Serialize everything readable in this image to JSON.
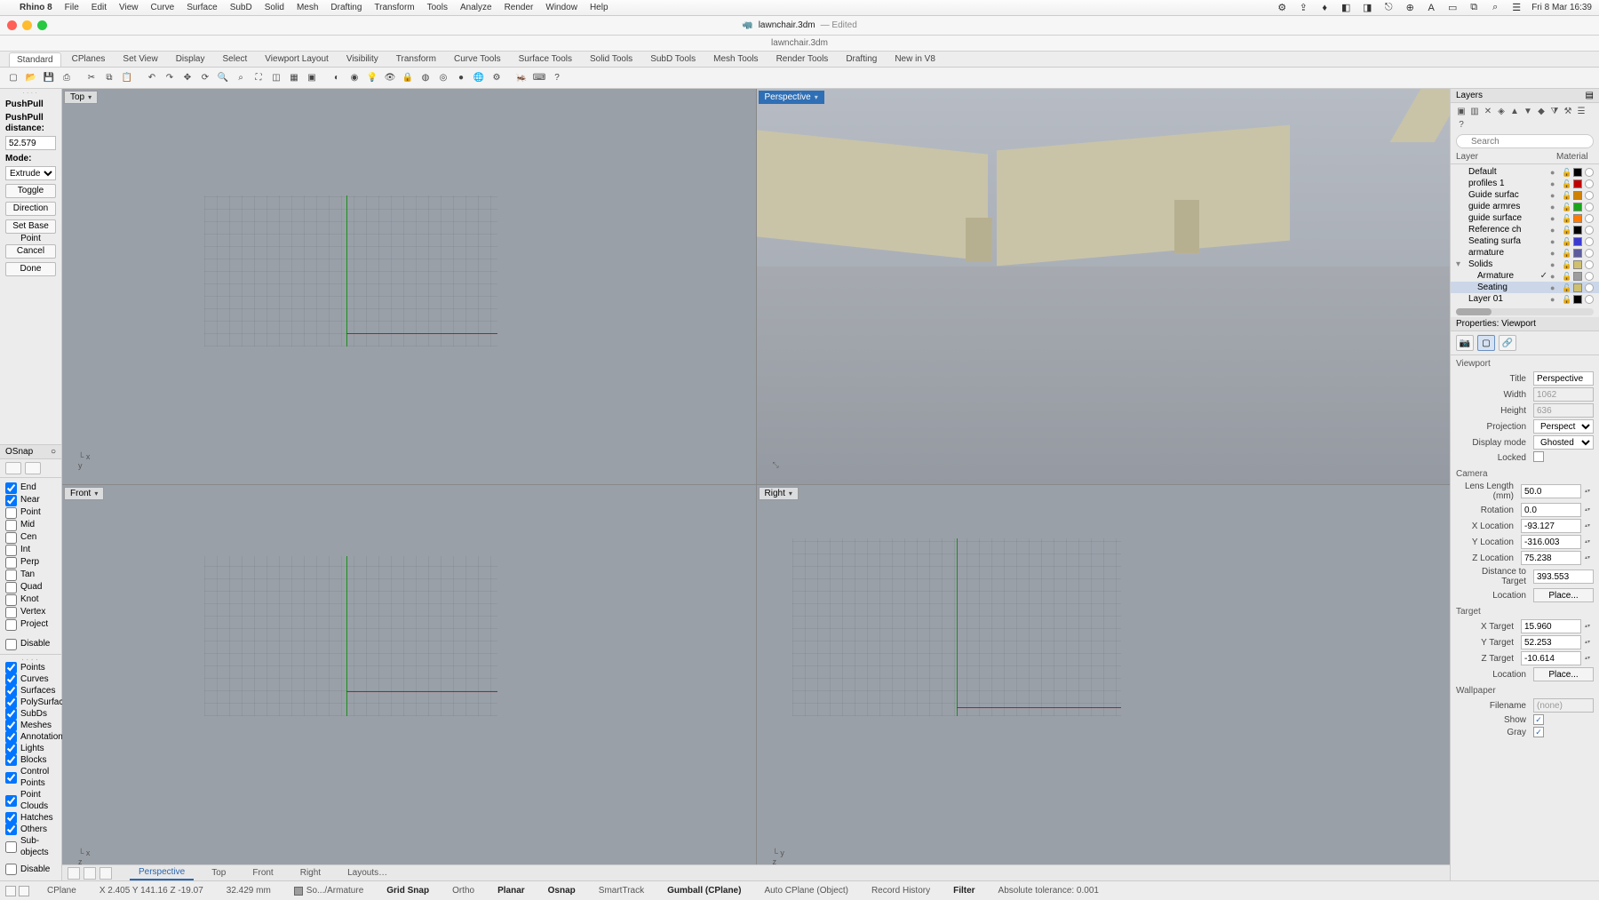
{
  "menubar": {
    "app": "Rhino 8",
    "items": [
      "File",
      "Edit",
      "View",
      "Curve",
      "Surface",
      "SubD",
      "Solid",
      "Mesh",
      "Drafting",
      "Transform",
      "Tools",
      "Analyze",
      "Render",
      "Window",
      "Help"
    ],
    "clock": "Fri 8 Mar 16:39"
  },
  "titlebar": {
    "doc_icon": "🦏",
    "filename": "lawnchair.3dm",
    "edited": "— Edited"
  },
  "subtitle": "lawnchair.3dm",
  "tooltabs": [
    "Standard",
    "CPlanes",
    "Set View",
    "Display",
    "Select",
    "Viewport Layout",
    "Visibility",
    "Transform",
    "Curve Tools",
    "Surface Tools",
    "Solid Tools",
    "SubD Tools",
    "Mesh Tools",
    "Render Tools",
    "Drafting",
    "New in V8"
  ],
  "activeTab": "Standard",
  "command": {
    "name": "PushPull",
    "dist_label": "PushPull distance:",
    "dist_value": "52.579",
    "mode_label": "Mode:",
    "mode_value": "Extrude",
    "toggle": "Toggle",
    "direction": "Direction",
    "setbase": "Set Base Point",
    "cancel": "Cancel",
    "done": "Done"
  },
  "osnap": {
    "title": "OSnap",
    "items": [
      {
        "label": "End",
        "on": true
      },
      {
        "label": "Near",
        "on": true
      },
      {
        "label": "Point",
        "on": false
      },
      {
        "label": "Mid",
        "on": false
      },
      {
        "label": "Cen",
        "on": false
      },
      {
        "label": "Int",
        "on": false
      },
      {
        "label": "Perp",
        "on": false
      },
      {
        "label": "Tan",
        "on": false
      },
      {
        "label": "Quad",
        "on": false
      },
      {
        "label": "Knot",
        "on": false
      },
      {
        "label": "Vertex",
        "on": false
      },
      {
        "label": "Project",
        "on": false
      }
    ],
    "disable": "Disable"
  },
  "selfilter": {
    "items": [
      {
        "label": "Points",
        "on": true
      },
      {
        "label": "Curves",
        "on": true
      },
      {
        "label": "Surfaces",
        "on": true
      },
      {
        "label": "PolySurfaces",
        "on": true
      },
      {
        "label": "SubDs",
        "on": true
      },
      {
        "label": "Meshes",
        "on": true
      },
      {
        "label": "Annotations",
        "on": true
      },
      {
        "label": "Lights",
        "on": true
      },
      {
        "label": "Blocks",
        "on": true
      },
      {
        "label": "Control Points",
        "on": true
      },
      {
        "label": "Point Clouds",
        "on": true
      },
      {
        "label": "Hatches",
        "on": true
      },
      {
        "label": "Others",
        "on": true
      },
      {
        "label": "Sub-objects",
        "on": false
      }
    ],
    "disable": "Disable"
  },
  "viewports": {
    "tl": "Top",
    "tr": "Perspective",
    "bl": "Front",
    "br": "Right",
    "active": "tr"
  },
  "layers": {
    "title": "Layers",
    "search_placeholder": "Search",
    "header": {
      "c1": "Layer",
      "c2": "Material"
    },
    "rows": [
      {
        "name": "Default",
        "color": "#000000",
        "indent": 0
      },
      {
        "name": "profiles 1",
        "color": "#c00000",
        "indent": 0
      },
      {
        "name": "Guide surfac",
        "color": "#d08000",
        "indent": 0
      },
      {
        "name": "guide armres",
        "color": "#1aa51a",
        "indent": 0
      },
      {
        "name": "guide surface",
        "color": "#ff7a00",
        "indent": 0
      },
      {
        "name": "Reference ch",
        "color": "#000000",
        "indent": 0
      },
      {
        "name": "Seating surfa",
        "color": "#3a3ad0",
        "indent": 0
      },
      {
        "name": "armature",
        "color": "#5c5c9e",
        "indent": 0
      },
      {
        "name": "Solids",
        "color": "#cfc070",
        "indent": 0,
        "tree": "▾"
      },
      {
        "name": "Armature",
        "color": "#9d9d9d",
        "indent": 1,
        "check": true
      },
      {
        "name": "Seating",
        "color": "#cfc070",
        "indent": 1,
        "sel": true
      },
      {
        "name": "Layer 01",
        "color": "#000000",
        "indent": 0
      }
    ]
  },
  "properties": {
    "title": "Properties: Viewport",
    "viewport": {
      "section": "Viewport",
      "title_label": "Title",
      "title_val": "Perspective",
      "width_label": "Width",
      "width_val": "1062",
      "height_label": "Height",
      "height_val": "636",
      "proj_label": "Projection",
      "proj_val": "Perspective",
      "disp_label": "Display mode",
      "disp_val": "Ghosted",
      "locked_label": "Locked"
    },
    "camera": {
      "section": "Camera",
      "lens_label": "Lens Length (mm)",
      "lens_val": "50.0",
      "rot_label": "Rotation",
      "rot_val": "0.0",
      "x_label": "X Location",
      "x_val": "-93.127",
      "y_label": "Y Location",
      "y_val": "-316.003",
      "z_label": "Z Location",
      "z_val": "75.238",
      "dist_label": "Distance to Target",
      "dist_val": "393.553",
      "loc_label": "Location",
      "place": "Place..."
    },
    "target": {
      "section": "Target",
      "x_label": "X Target",
      "x_val": "15.960",
      "y_label": "Y Target",
      "y_val": "52.253",
      "z_label": "Z Target",
      "z_val": "-10.614",
      "loc_label": "Location",
      "place": "Place..."
    },
    "wallpaper": {
      "section": "Wallpaper",
      "file_label": "Filename",
      "file_val": "(none)",
      "show_label": "Show",
      "gray_label": "Gray"
    }
  },
  "viewtabs": {
    "tabs": [
      "Perspective",
      "Top",
      "Front",
      "Right",
      "Layouts…"
    ],
    "active": "Perspective"
  },
  "status": {
    "cplane": "CPlane",
    "coords": "X 2.405 Y 141.16 Z -19.07",
    "dim": "32.429 mm",
    "layer": "So.../Armature",
    "items": [
      "Grid Snap",
      "Ortho",
      "Planar",
      "Osnap",
      "SmartTrack",
      "Gumball (CPlane)",
      "Auto CPlane (Object)",
      "Record History",
      "Filter"
    ],
    "bold": [
      "Grid Snap",
      "Planar",
      "Osnap",
      "Gumball (CPlane)",
      "Filter"
    ],
    "tol": "Absolute tolerance: 0.001"
  }
}
